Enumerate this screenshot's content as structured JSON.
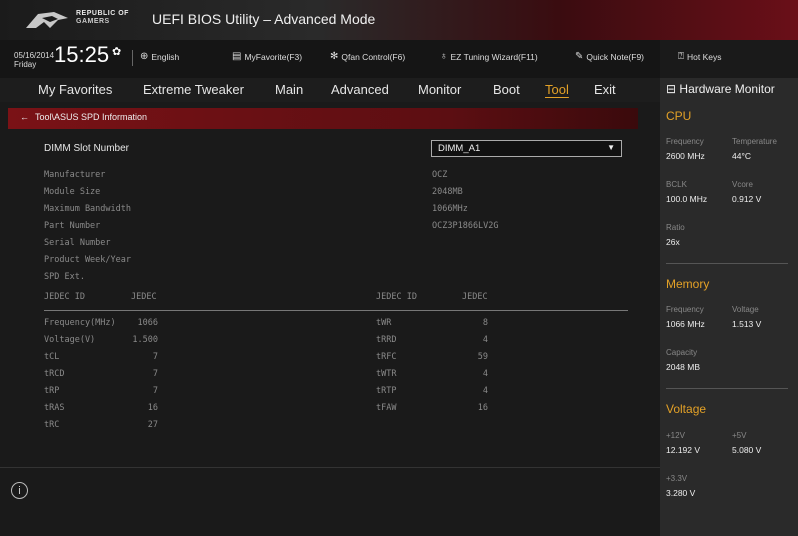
{
  "header": {
    "brand_line1": "REPUBLIC OF",
    "brand_line2": "GAMERS",
    "title": "UEFI BIOS Utility – Advanced Mode"
  },
  "infobar": {
    "date": "05/16/2014",
    "day": "Friday",
    "time": "15:25",
    "language": "English",
    "myfavorite": "MyFavorite(F3)",
    "qfan": "Qfan Control(F6)",
    "ez_tuning": "EZ Tuning Wizard(F11)",
    "quick_note": "Quick Note(F9)",
    "hot_keys": "Hot Keys"
  },
  "menu": [
    "My Favorites",
    "Extreme Tweaker",
    "Main",
    "Advanced",
    "Monitor",
    "Boot",
    "Tool",
    "Exit"
  ],
  "active_menu": "Tool",
  "breadcrumb": "Tool\\ASUS SPD Information",
  "spd": {
    "dimm_slot_label": "DIMM Slot Number",
    "dimm_slot_value": "DIMM_A1",
    "fields": [
      {
        "label": "Manufacturer",
        "value": "OCZ"
      },
      {
        "label": "Module Size",
        "value": "2048MB"
      },
      {
        "label": "Maximum Bandwidth",
        "value": "1066MHz"
      },
      {
        "label": "Part Number",
        "value": "OCZ3P1866LV2G"
      },
      {
        "label": "Serial Number",
        "value": ""
      },
      {
        "label": "Product Week/Year",
        "value": ""
      },
      {
        "label": "SPD Ext.",
        "value": ""
      }
    ],
    "jedec_header": {
      "left_id": "JEDEC ID",
      "left_val": "JEDEC",
      "right_id": "JEDEC ID",
      "right_val": "JEDEC"
    },
    "left_rows": [
      {
        "label": "Frequency(MHz)",
        "value": "1066"
      },
      {
        "label": "Voltage(V)",
        "value": "1.500"
      },
      {
        "label": "tCL",
        "value": "7"
      },
      {
        "label": "tRCD",
        "value": "7"
      },
      {
        "label": "tRP",
        "value": "7"
      },
      {
        "label": "tRAS",
        "value": "16"
      },
      {
        "label": "tRC",
        "value": "27"
      }
    ],
    "right_rows": [
      {
        "label": "tWR",
        "value": "8"
      },
      {
        "label": "tRRD",
        "value": "4"
      },
      {
        "label": "tRFC",
        "value": "59"
      },
      {
        "label": "tWTR",
        "value": "4"
      },
      {
        "label": "tRTP",
        "value": "4"
      },
      {
        "label": "tFAW",
        "value": "16"
      }
    ]
  },
  "hardware_monitor": {
    "title": "Hardware Monitor",
    "cpu": {
      "heading": "CPU",
      "frequency_label": "Frequency",
      "frequency": "2600 MHz",
      "temperature_label": "Temperature",
      "temperature": "44°C",
      "bclk_label": "BCLK",
      "bclk": "100.0 MHz",
      "vcore_label": "Vcore",
      "vcore": "0.912 V",
      "ratio_label": "Ratio",
      "ratio": "26x"
    },
    "memory": {
      "heading": "Memory",
      "frequency_label": "Frequency",
      "frequency": "1066 MHz",
      "voltage_label": "Voltage",
      "voltage": "1.513 V",
      "capacity_label": "Capacity",
      "capacity": "2048 MB"
    },
    "voltage": {
      "heading": "Voltage",
      "v12_label": "+12V",
      "v12": "12.192 V",
      "v5_label": "+5V",
      "v5": "5.080 V",
      "v33_label": "+3.3V",
      "v33": "3.280 V"
    }
  },
  "colors": {
    "accent": "#e3a127",
    "breadcrumb": "#7a1216"
  }
}
